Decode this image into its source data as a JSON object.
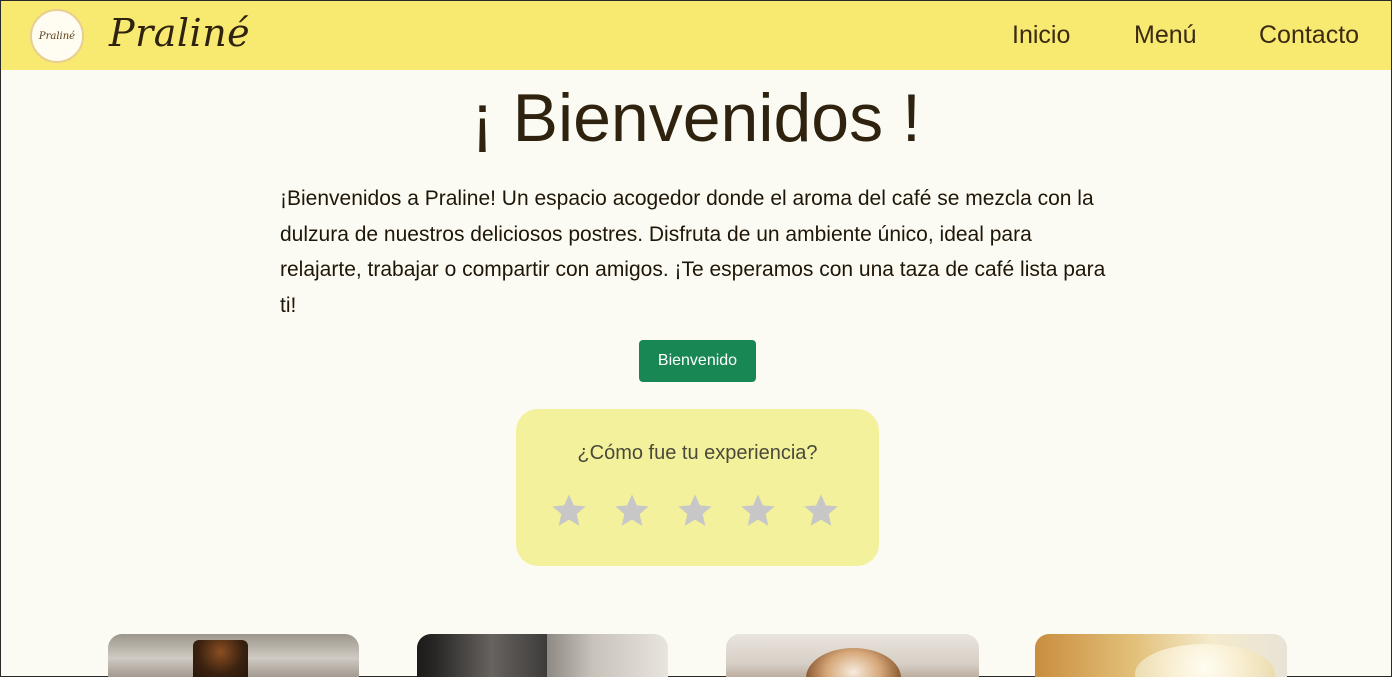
{
  "header": {
    "logo_text": "Praliné",
    "brand": "Praliné",
    "nav": [
      {
        "label": "Inicio"
      },
      {
        "label": "Menú"
      },
      {
        "label": "Contacto"
      }
    ]
  },
  "main": {
    "title": "¡ Bienvenidos !",
    "intro": "¡Bienvenidos a Praline! Un espacio acogedor donde el aroma del café se mezcla con la dulzura de nuestros deliciosos postres. Disfruta de un ambiente único, ideal para relajarte, trabajar o compartir con amigos. ¡Te esperamos con una taza de café lista para ti!",
    "button_label": "Bienvenido"
  },
  "rating": {
    "question": "¿Cómo fue tu experiencia?",
    "max_stars": 5,
    "selected": 0
  },
  "colors": {
    "navbar": "#f8e971",
    "background": "#fbfbf3",
    "button": "#198754",
    "rating_card": "#f3f19c",
    "star_inactive": "#c7c7c7"
  }
}
